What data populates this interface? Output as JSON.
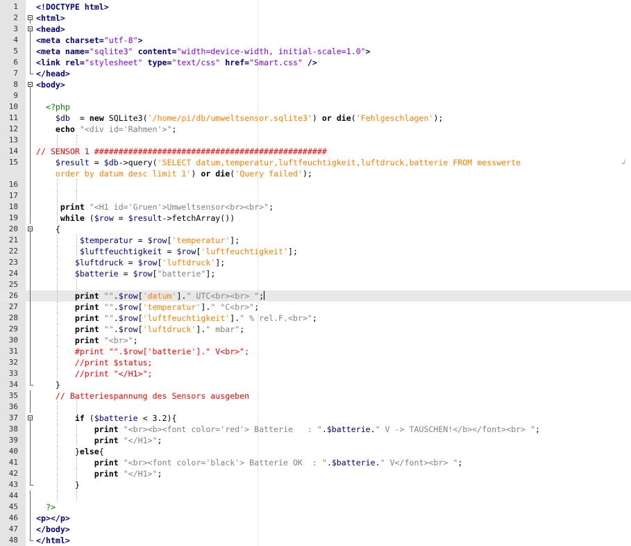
{
  "editor": {
    "wrap_symbol": "↲"
  },
  "lines": [
    {
      "n": "1",
      "fold": "",
      "c": [
        [
          "tag",
          "<!DOCTYPE html>"
        ]
      ]
    },
    {
      "n": "2",
      "fold": "box",
      "c": [
        [
          "tag",
          "<html>"
        ]
      ]
    },
    {
      "n": "3",
      "fold": "box",
      "c": [
        [
          "tag",
          "<head>"
        ]
      ]
    },
    {
      "n": "4",
      "fold": "v",
      "c": [
        [
          "tag",
          "<meta charset="
        ],
        [
          "hstr",
          "\"utf-8\""
        ],
        [
          "tag",
          ">"
        ]
      ]
    },
    {
      "n": "5",
      "fold": "v",
      "c": [
        [
          "tag",
          "<meta name="
        ],
        [
          "hstr",
          "\"sqlite3\""
        ],
        [
          "tag",
          " content="
        ],
        [
          "hstr",
          "\"width=device-width, initial-scale=1.0\""
        ],
        [
          "tag",
          ">"
        ]
      ]
    },
    {
      "n": "6",
      "fold": "v",
      "c": [
        [
          "tag",
          "<link rel="
        ],
        [
          "hstr",
          "\"stylesheet\""
        ],
        [
          "tag",
          " type="
        ],
        [
          "hstr",
          "\"text/css\""
        ],
        [
          "tag",
          " href="
        ],
        [
          "hstr",
          "\"Smart.css\""
        ],
        [
          "tag",
          " />"
        ]
      ]
    },
    {
      "n": "7",
      "fold": "end",
      "c": [
        [
          "tag",
          "</head>"
        ]
      ]
    },
    {
      "n": "8",
      "fold": "box",
      "c": [
        [
          "tag",
          "<body>"
        ]
      ]
    },
    {
      "n": "9",
      "fold": "v",
      "c": []
    },
    {
      "n": "10",
      "fold": "v",
      "c": [
        [
          "",
          "  "
        ],
        [
          "php",
          "<?php"
        ]
      ]
    },
    {
      "n": "11",
      "fold": "v",
      "c": [
        [
          "",
          "    "
        ],
        [
          "var",
          "$db"
        ],
        [
          "",
          "  = "
        ],
        [
          "bold",
          "new"
        ],
        [
          "",
          " SQLite3("
        ],
        [
          "sq",
          "'/home/pi/db/umweltsensor.sqlite3'"
        ],
        [
          "",
          ") "
        ],
        [
          "bold",
          "or"
        ],
        [
          "",
          " "
        ],
        [
          "bold",
          "die"
        ],
        [
          "",
          "("
        ],
        [
          "sq",
          "'Fehlgeschlagen'"
        ],
        [
          "",
          ");"
        ]
      ]
    },
    {
      "n": "12",
      "fold": "v",
      "c": [
        [
          "",
          "    "
        ],
        [
          "bold",
          "echo"
        ],
        [
          "",
          " "
        ],
        [
          "str",
          "\"<div id='Rahmen'>\""
        ],
        [
          "",
          ";"
        ]
      ]
    },
    {
      "n": "13",
      "fold": "v",
      "c": []
    },
    {
      "n": "14",
      "fold": "v",
      "c": [
        [
          "cm",
          "// SENSOR 1 ################################################"
        ]
      ]
    },
    {
      "n": "15",
      "fold": "v",
      "wrap": true,
      "c": [
        [
          "",
          "    "
        ],
        [
          "var",
          "$result"
        ],
        [
          "",
          " = "
        ],
        [
          "var",
          "$db"
        ],
        [
          "",
          "->query("
        ],
        [
          "sq",
          "'SELECT datum,temperatur,luftfeuchtigkeit,luftdruck,batterie FROM messwerte"
        ]
      ]
    },
    {
      "n": "",
      "fold": "v",
      "c": [
        [
          "",
          "    "
        ],
        [
          "sq",
          "order by datum desc limit 1'"
        ],
        [
          "",
          ") "
        ],
        [
          "bold",
          "or"
        ],
        [
          "",
          " "
        ],
        [
          "bold",
          "die"
        ],
        [
          "",
          "("
        ],
        [
          "sq",
          "'Query failed'"
        ],
        [
          "",
          ");"
        ]
      ]
    },
    {
      "n": "16",
      "fold": "v",
      "c": []
    },
    {
      "n": "17",
      "fold": "v",
      "c": []
    },
    {
      "n": "18",
      "fold": "v",
      "c": [
        [
          "",
          "     "
        ],
        [
          "bold",
          "print"
        ],
        [
          "",
          " "
        ],
        [
          "str",
          "\"<H1 id='Gruen'>Umweltsensor<br><br>\""
        ],
        [
          "",
          ";"
        ]
      ]
    },
    {
      "n": "19",
      "fold": "v",
      "c": [
        [
          "",
          "     "
        ],
        [
          "bold",
          "while"
        ],
        [
          "",
          " ("
        ],
        [
          "var",
          "$row"
        ],
        [
          "",
          " = "
        ],
        [
          "var",
          "$result"
        ],
        [
          "",
          "->fetchArray())"
        ]
      ]
    },
    {
      "n": "20",
      "fold": "box",
      "c": [
        [
          "",
          "    {"
        ]
      ]
    },
    {
      "n": "21",
      "fold": "v",
      "c": [
        [
          "",
          "         "
        ],
        [
          "var",
          "$temperatur"
        ],
        [
          "",
          " = "
        ],
        [
          "var",
          "$row"
        ],
        [
          "",
          "["
        ],
        [
          "sq",
          "'temperatur'"
        ],
        [
          "",
          "];"
        ]
      ]
    },
    {
      "n": "22",
      "fold": "v",
      "c": [
        [
          "",
          "         "
        ],
        [
          "var",
          "$luftfeuchtigkeit"
        ],
        [
          "",
          " = "
        ],
        [
          "var",
          "$row"
        ],
        [
          "",
          "["
        ],
        [
          "sq",
          "'luftfeuchtigkeit'"
        ],
        [
          "",
          "];"
        ]
      ]
    },
    {
      "n": "23",
      "fold": "v",
      "c": [
        [
          "",
          "        "
        ],
        [
          "var",
          "$luftdruck"
        ],
        [
          "",
          " = "
        ],
        [
          "var",
          "$row"
        ],
        [
          "",
          "["
        ],
        [
          "sq",
          "'luftdruck'"
        ],
        [
          "",
          "];"
        ]
      ]
    },
    {
      "n": "24",
      "fold": "v",
      "c": [
        [
          "",
          "        "
        ],
        [
          "var",
          "$batterie"
        ],
        [
          "",
          " = "
        ],
        [
          "var",
          "$row"
        ],
        [
          "",
          "["
        ],
        [
          "str",
          "\"batterie\""
        ],
        [
          "",
          "];"
        ]
      ]
    },
    {
      "n": "25",
      "fold": "v",
      "c": []
    },
    {
      "n": "26",
      "fold": "v",
      "current": true,
      "c": [
        [
          "",
          "        "
        ],
        [
          "bold",
          "print"
        ],
        [
          "",
          " "
        ],
        [
          "str",
          "\"\""
        ],
        [
          "",
          "."
        ],
        [
          "var",
          "$row"
        ],
        [
          "",
          "["
        ],
        [
          "sq",
          "'datum'"
        ],
        [
          "",
          "]."
        ],
        [
          "str",
          "\" UTC<br><br> \""
        ],
        [
          "",
          ";"
        ],
        [
          "caret",
          ""
        ]
      ]
    },
    {
      "n": "27",
      "fold": "v",
      "c": [
        [
          "",
          "        "
        ],
        [
          "bold",
          "print"
        ],
        [
          "",
          " "
        ],
        [
          "str",
          "\"\""
        ],
        [
          "",
          "."
        ],
        [
          "var",
          "$row"
        ],
        [
          "",
          "["
        ],
        [
          "sq",
          "'temperatur'"
        ],
        [
          "",
          "]."
        ],
        [
          "str",
          "\" °C<br>\""
        ],
        [
          "",
          ";"
        ]
      ]
    },
    {
      "n": "28",
      "fold": "v",
      "c": [
        [
          "",
          "        "
        ],
        [
          "bold",
          "print"
        ],
        [
          "",
          " "
        ],
        [
          "str",
          "\"\""
        ],
        [
          "",
          "."
        ],
        [
          "var",
          "$row"
        ],
        [
          "",
          "["
        ],
        [
          "sq",
          "'luftfeuchtigkeit'"
        ],
        [
          "",
          "]."
        ],
        [
          "str",
          "\" % rel.F.<br>\""
        ],
        [
          "",
          ";"
        ]
      ]
    },
    {
      "n": "29",
      "fold": "v",
      "c": [
        [
          "",
          "        "
        ],
        [
          "bold",
          "print"
        ],
        [
          "",
          " "
        ],
        [
          "str",
          "\"\""
        ],
        [
          "",
          "."
        ],
        [
          "var",
          "$row"
        ],
        [
          "",
          "["
        ],
        [
          "sq",
          "'luftdruck'"
        ],
        [
          "",
          "]."
        ],
        [
          "str",
          "\" mbar\""
        ],
        [
          "",
          ";"
        ]
      ]
    },
    {
      "n": "30",
      "fold": "v",
      "c": [
        [
          "",
          "        "
        ],
        [
          "bold",
          "print"
        ],
        [
          "",
          " "
        ],
        [
          "str",
          "\"<br>\""
        ],
        [
          "",
          ";"
        ]
      ]
    },
    {
      "n": "31",
      "fold": "v",
      "c": [
        [
          "",
          "        "
        ],
        [
          "cm",
          "#print \"\".$row['batterie'].\" V<br>\";"
        ]
      ]
    },
    {
      "n": "32",
      "fold": "v",
      "c": [
        [
          "",
          "        "
        ],
        [
          "cm",
          "//print $status;"
        ]
      ]
    },
    {
      "n": "33",
      "fold": "v",
      "c": [
        [
          "",
          "        "
        ],
        [
          "cm",
          "//print \"</H1>\";"
        ]
      ]
    },
    {
      "n": "34",
      "fold": "end",
      "c": [
        [
          "",
          "    }"
        ]
      ]
    },
    {
      "n": "35",
      "fold": "v",
      "c": [
        [
          "",
          "    "
        ],
        [
          "cm",
          "// Batteriespannung des Sensors ausgeben"
        ]
      ]
    },
    {
      "n": "36",
      "fold": "v",
      "c": []
    },
    {
      "n": "37",
      "fold": "box",
      "c": [
        [
          "",
          "        "
        ],
        [
          "bold",
          "if"
        ],
        [
          "",
          " ("
        ],
        [
          "var",
          "$batterie"
        ],
        [
          "",
          " < 3.2){"
        ]
      ]
    },
    {
      "n": "38",
      "fold": "v",
      "c": [
        [
          "",
          "            "
        ],
        [
          "bold",
          "print"
        ],
        [
          "",
          " "
        ],
        [
          "str",
          "\"<br><b><font color='red'> Batterie   : \""
        ],
        [
          "",
          "."
        ],
        [
          "var",
          "$batterie"
        ],
        [
          "",
          "."
        ],
        [
          "str",
          "\" V -> TAUSCHEN!</b></font><br> \""
        ],
        [
          "",
          ";"
        ]
      ]
    },
    {
      "n": "39",
      "fold": "v",
      "c": [
        [
          "",
          "            "
        ],
        [
          "bold",
          "print"
        ],
        [
          "",
          " "
        ],
        [
          "str",
          "\"</H1>\""
        ],
        [
          "",
          ";"
        ]
      ]
    },
    {
      "n": "40",
      "fold": "v",
      "c": [
        [
          "",
          "        }"
        ],
        [
          "bold",
          "else"
        ],
        [
          "",
          "{"
        ]
      ]
    },
    {
      "n": "41",
      "fold": "v",
      "c": [
        [
          "",
          "            "
        ],
        [
          "bold",
          "print"
        ],
        [
          "",
          " "
        ],
        [
          "str",
          "\"<br><font color='black'> Batterie OK  : \""
        ],
        [
          "",
          "."
        ],
        [
          "var",
          "$batterie"
        ],
        [
          "",
          "."
        ],
        [
          "str",
          "\" V</font><br> \""
        ],
        [
          "",
          ";"
        ]
      ]
    },
    {
      "n": "42",
      "fold": "v",
      "c": [
        [
          "",
          "            "
        ],
        [
          "bold",
          "print"
        ],
        [
          "",
          " "
        ],
        [
          "str",
          "\"</H1>\""
        ],
        [
          "",
          ";"
        ]
      ]
    },
    {
      "n": "43",
      "fold": "end",
      "c": [
        [
          "",
          "        }"
        ]
      ]
    },
    {
      "n": "44",
      "fold": "v",
      "c": []
    },
    {
      "n": "45",
      "fold": "v",
      "c": [
        [
          "",
          "  "
        ],
        [
          "php",
          "?>"
        ]
      ]
    },
    {
      "n": "46",
      "fold": "v",
      "c": [
        [
          "tag",
          "<p></p>"
        ]
      ]
    },
    {
      "n": "47",
      "fold": "v",
      "c": [
        [
          "tag",
          "</body>"
        ]
      ]
    },
    {
      "n": "48",
      "fold": "end",
      "c": [
        [
          "tag",
          "</html>"
        ]
      ]
    }
  ]
}
